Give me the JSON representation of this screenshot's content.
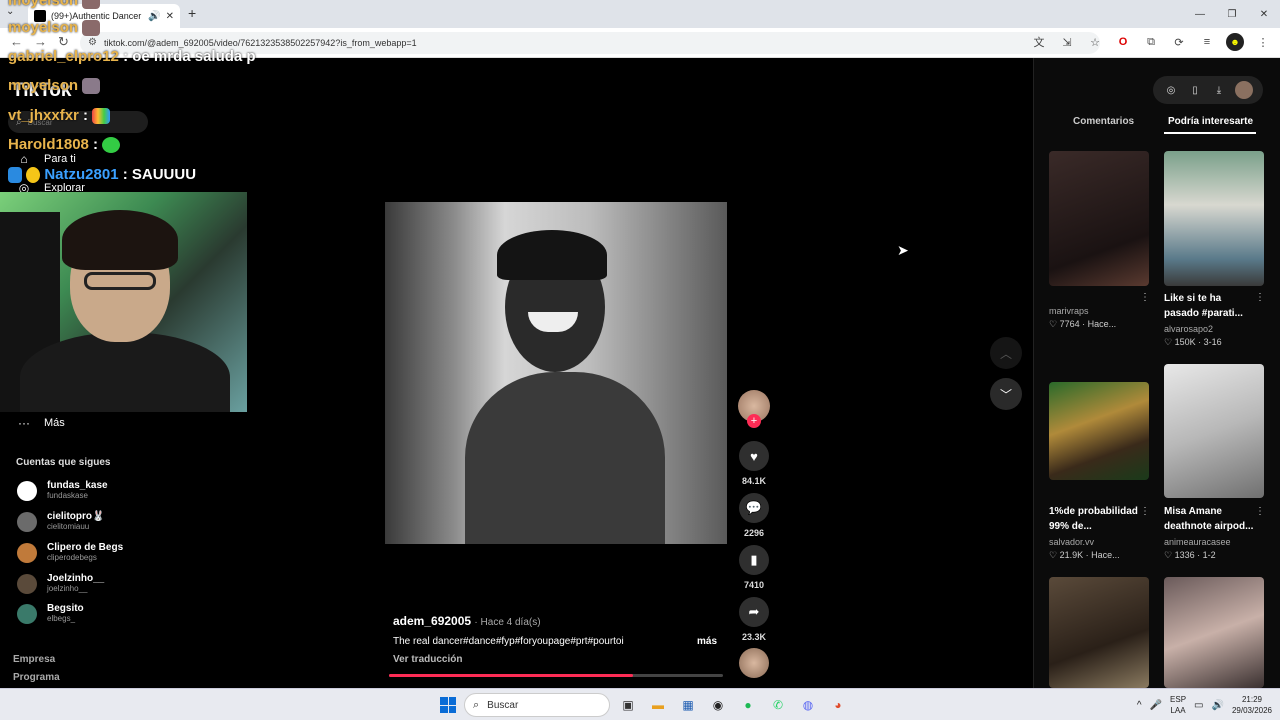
{
  "browser": {
    "tab_title": "(99+)Authentic Dancer vs. I",
    "url": "tiktok.com/@adem_692005/video/7621323538502257942?is_from_webapp=1"
  },
  "stream_overlay": {
    "chat": [
      {
        "user": "moyelson",
        "message": ""
      },
      {
        "user": "moyelson",
        "message": ""
      },
      {
        "user": "gabriel_elpro12",
        "message": ": oe mrda saluda p"
      },
      {
        "user": "moyelson",
        "message": ""
      },
      {
        "user": "vt_jhxxfxr",
        "message": ":"
      },
      {
        "user": "Harold1808",
        "message": ":"
      },
      {
        "user": "Natzu2801",
        "message": ": SAUUUU"
      }
    ]
  },
  "sidebar": {
    "logo": "TikTok",
    "search_placeholder": "Buscar",
    "nav": [
      {
        "label": "Para ti",
        "icon": "home-icon"
      },
      {
        "label": "Explorar",
        "icon": "compass-icon"
      },
      {
        "label": "Más",
        "icon": "more-icon"
      }
    ],
    "following_title": "Cuentas que sigues",
    "following": [
      {
        "name": "fundas_kase",
        "handle": "fundaskase",
        "color": "#ffffff"
      },
      {
        "name": "cielitopro🐰",
        "handle": "cielitomiauu",
        "color": "#6b6b6b"
      },
      {
        "name": "Clipero de Begs",
        "handle": "cliperodebegs",
        "color": "#c07a3a"
      },
      {
        "name": "Joelzinho__",
        "handle": "joelzinho__",
        "color": "#5a4a3a"
      },
      {
        "name": "Begsito",
        "handle": "elbegs_",
        "color": "#3a7a6a"
      }
    ],
    "footer": [
      "Empresa",
      "Programa"
    ]
  },
  "video": {
    "author": "adem_692005",
    "posted": "· Hace 4 día(s)",
    "caption": "The real dancer#dance#fyp#foryoupage#prt#pourtoi",
    "more_label": "más",
    "translate_label": "Ver traducción",
    "progress": 0.73
  },
  "actions": {
    "likes": "84.1K",
    "comments": "2296",
    "saves": "7410",
    "shares": "23.3K"
  },
  "right_panel": {
    "tabs": [
      "Comentarios",
      "Podría interesarte"
    ],
    "active_tab": "Podría interesarte",
    "cards": [
      {
        "title": "",
        "user": "marivraps",
        "likes": "♡ 7764",
        "date": "Hace..."
      },
      {
        "title": "Like si te ha pasado #parati...",
        "user": "alvarosapo2",
        "likes": "♡ 150K",
        "date": "3-16"
      },
      {
        "title": "1%de probabilidad 99% de...",
        "user": "salvador.vv",
        "likes": "♡ 21.9K",
        "date": "Hace..."
      },
      {
        "title": "Misa Amane deathnote airpod...",
        "user": "animeauracasee",
        "likes": "♡ 1336",
        "date": "1-2"
      }
    ]
  },
  "taskbar": {
    "search_label": "Buscar",
    "lang_line1": "ESP",
    "lang_line2": "LAA",
    "time": "21:29",
    "date": "29/03/2026"
  },
  "colors": {
    "accent": "#fe2c55",
    "background": "#000000"
  }
}
